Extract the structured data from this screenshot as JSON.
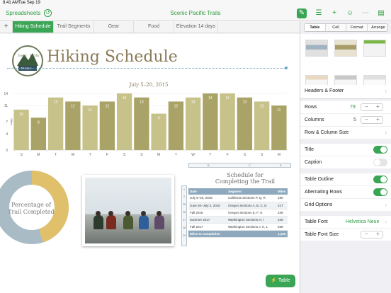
{
  "status": {
    "time": "8:41 AM",
    "day": "Tue Sep 19"
  },
  "toolbar": {
    "back_label": "Spreadsheets",
    "title": "Scenic Pacific Trails"
  },
  "tabs": [
    "Hiking Schedule",
    "Trail Segments",
    "Gear",
    "Food",
    "Elevation 14 days"
  ],
  "sheet": {
    "heading": "Hiking Schedule",
    "logo_text": [
      "Scenic",
      "Pacific",
      "TRAILS"
    ],
    "donut_label": "Percentage of Trail Completed",
    "table_title": "Schedule for Completing the Trail"
  },
  "chart_data": {
    "type": "bar",
    "title": "July 5–20, 2015",
    "ylabel": "Miles",
    "categories": [
      "S",
      "M",
      "T",
      "W",
      "T",
      "F",
      "S",
      "S",
      "M",
      "T",
      "W",
      "T",
      "F",
      "S",
      "S",
      "M"
    ],
    "values": [
      10,
      8,
      13,
      12,
      11,
      12,
      14,
      13,
      9,
      12,
      13,
      14,
      14,
      13,
      12,
      11
    ],
    "ylim": [
      0,
      14
    ],
    "yticks": [
      0,
      4,
      7,
      11,
      14
    ],
    "colors": {
      "bar": "#c7c28a",
      "bar_alt": "#a9a367"
    }
  },
  "donut_data": {
    "completed": 45,
    "remaining": 55,
    "colors": {
      "completed": "#e0c06a",
      "remaining": "#a9bcc6"
    }
  },
  "table": {
    "columns": [
      "Date",
      "Segment",
      "Miles"
    ],
    "col_letters": [
      "B",
      "C",
      "E"
    ],
    "rows": [
      [
        "July 5–20, 2015",
        "California Sections P, Q, R",
        "190"
      ],
      [
        "June 20–July 2, 2016",
        "Oregon Sections A, B, C, D",
        "217"
      ],
      [
        "Fall 2016",
        "Oregon Sections E, F, G",
        "239"
      ],
      [
        "Summer 2017",
        "Washington Sections H, I",
        "246"
      ],
      [
        "Fall 2017",
        "Washington Sections J, K, L",
        "258"
      ]
    ],
    "row_numbers": [
      "1",
      "2",
      "25",
      "26",
      "27",
      "28",
      "29"
    ],
    "footer": [
      "Miles to Completion",
      "",
      "1,150"
    ]
  },
  "fab_label": "Table",
  "panel": {
    "segments": [
      "Table",
      "Cell",
      "Format",
      "Arrange"
    ],
    "headers_footer": "Headers & Footer",
    "rows_label": "Rows",
    "rows_value": "79",
    "columns_label": "Columns",
    "columns_value": "5",
    "row_col_size": "Row & Column Size",
    "title_label": "Title",
    "caption_label": "Caption",
    "table_outline_label": "Table Outline",
    "alternating_rows_label": "Alternating Rows",
    "grid_options": "Grid Options",
    "table_font_label": "Table Font",
    "table_font_value": "Helvetica Neue",
    "table_font_size_label": "Table Font Size"
  }
}
